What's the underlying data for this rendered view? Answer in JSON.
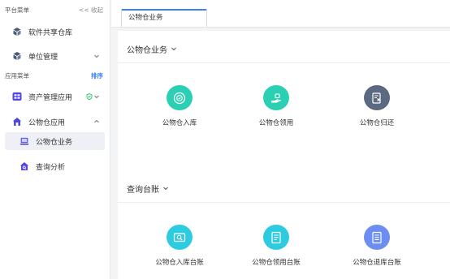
{
  "sidebar": {
    "platform_section": {
      "title": "平台菜单",
      "collapse_label": "<< 收起"
    },
    "platform_items": [
      {
        "label": "软件共享仓库"
      },
      {
        "label": "单位管理"
      }
    ],
    "app_section": {
      "title": "应用菜单",
      "sort_label": "排序"
    },
    "app_items": [
      {
        "label": "资产管理应用"
      },
      {
        "label": "公物仓应用"
      }
    ],
    "sub_items": [
      {
        "label": "公物仓业务"
      },
      {
        "label": "查询分析"
      }
    ]
  },
  "tabs": [
    {
      "label": "公物仓业务"
    }
  ],
  "groups": [
    {
      "title": "公物仓业务",
      "tiles": [
        {
          "label": "公物仓入库",
          "icon": "inbound-icon",
          "color": "#2bcfb3"
        },
        {
          "label": "公物仓领用",
          "icon": "receive-icon",
          "color": "#2bcfb3"
        },
        {
          "label": "公物仓归还",
          "icon": "return-icon",
          "color": "#5b6a80"
        }
      ]
    },
    {
      "title": "查询台账",
      "tiles": [
        {
          "label": "公物仓入库台账",
          "icon": "inbound-ledger-icon",
          "color": "#2dcbe0"
        },
        {
          "label": "公物仓领用台账",
          "icon": "receive-ledger-icon",
          "color": "#2dcbe0"
        },
        {
          "label": "公物仓退库台账",
          "icon": "return-ledger-icon",
          "color": "#6c8ef0"
        }
      ]
    }
  ],
  "colors": {
    "accent": "#3b82f6",
    "menu_icon": "#4a5b78",
    "house_icon": "#4f46e5",
    "shield": "#22c55e"
  }
}
